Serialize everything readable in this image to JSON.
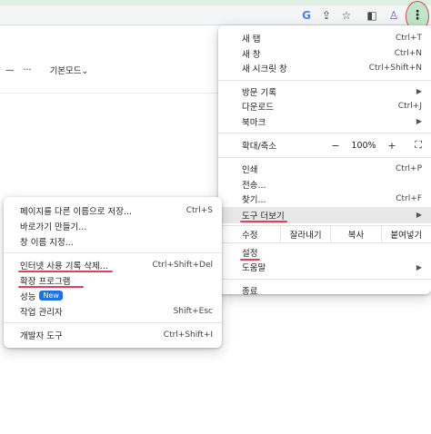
{
  "toolbar": {
    "icons": [
      "google-icon",
      "share-icon",
      "star-icon",
      "sidepanel-icon",
      "extension-icon",
      "kebab-menu-icon"
    ],
    "google_glyph": "G",
    "share_glyph": "⇪",
    "star_glyph": "☆",
    "sidepanel_glyph": "◧",
    "extension_glyph": "♙",
    "kebab_glyph": "⋮"
  },
  "page": {
    "dash_glyph": "—",
    "more_glyph": "···",
    "mode_label": "기본모드",
    "mode_chevron": "⌄"
  },
  "main_menu": {
    "new_tab": {
      "label": "새 탭",
      "shortcut": "Ctrl+T"
    },
    "new_window": {
      "label": "새 창",
      "shortcut": "Ctrl+N"
    },
    "new_incognito": {
      "label": "새 시크릿 창",
      "shortcut": "Ctrl+Shift+N"
    },
    "history": {
      "label": "방문 기록"
    },
    "downloads": {
      "label": "다운로드",
      "shortcut": "Ctrl+J"
    },
    "bookmarks": {
      "label": "북마크"
    },
    "zoom": {
      "label": "확대/축소",
      "minus": "−",
      "value": "100%",
      "plus": "+",
      "fullscreen": "⛶"
    },
    "print": {
      "label": "인쇄",
      "shortcut": "Ctrl+P"
    },
    "cast": {
      "label": "전송..."
    },
    "find": {
      "label": "찾기...",
      "shortcut": "Ctrl+F"
    },
    "more_tools": {
      "label": "도구 더보기"
    },
    "edit": {
      "label": "수정",
      "cut": "잘라내기",
      "copy": "복사",
      "paste": "붙여넣기"
    },
    "settings": {
      "label": "설정"
    },
    "help": {
      "label": "도움말"
    },
    "exit": {
      "label": "종료"
    },
    "arrow": "▶"
  },
  "sub_menu": {
    "save_page": {
      "label": "페이지를 다른 이름으로 저장...",
      "shortcut": "Ctrl+S"
    },
    "create_shortcut": {
      "label": "바로가기 만들기..."
    },
    "name_window": {
      "label": "창 이름 지정..."
    },
    "clear_data": {
      "label": "인터넷 사용 기록 삭제...",
      "shortcut": "Ctrl+Shift+Del"
    },
    "extensions": {
      "label": "확장 프로그램"
    },
    "performance": {
      "label": "성능",
      "badge": "New"
    },
    "task_manager": {
      "label": "작업 관리자",
      "shortcut": "Shift+Esc"
    },
    "dev_tools": {
      "label": "개발자 도구",
      "shortcut": "Ctrl+Shift+I"
    }
  },
  "colors": {
    "annotation": "#e2405a",
    "badge": "#1a73e8",
    "highlight_circle": "#bfe6c6",
    "top_strip": "#dff0e2"
  }
}
